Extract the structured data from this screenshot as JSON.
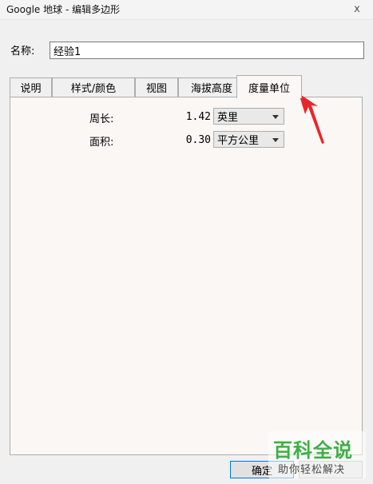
{
  "window": {
    "title": "Google 地球 - 编辑多边形",
    "close_glyph": "x"
  },
  "name_field": {
    "label": "名称:",
    "value": "经验1"
  },
  "tabs": [
    {
      "label": "说明",
      "active": false
    },
    {
      "label": "样式/颜色",
      "active": false
    },
    {
      "label": "视图",
      "active": false
    },
    {
      "label": "海拔高度",
      "active": false
    },
    {
      "label": "度量单位",
      "active": true
    }
  ],
  "measurements": {
    "perimeter": {
      "label": "周长:",
      "value": "1.42",
      "unit": "英里"
    },
    "area": {
      "label": "面积:",
      "value": "0.30",
      "unit": "平方公里"
    }
  },
  "buttons": {
    "ok_label": "确定"
  },
  "watermark": {
    "title": "百科全说",
    "subtitle": "助你轻松解决"
  },
  "colors": {
    "annotation_arrow": "#e8262b",
    "watermark_green": "#3cb043",
    "panel_bg": "#faf7f4"
  }
}
